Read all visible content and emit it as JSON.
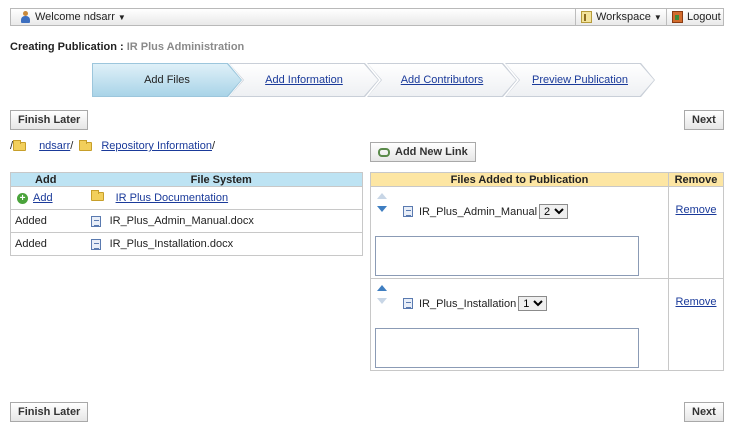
{
  "topbar": {
    "user_label": "Welcome ndsarr",
    "workspace_label": "Workspace",
    "logout_label": "Logout"
  },
  "page": {
    "title_prefix": "Creating Publication : ",
    "title_repo": "IR Plus Administration"
  },
  "steps": [
    {
      "label": "Add Files",
      "active": true
    },
    {
      "label": "Add Information",
      "active": false
    },
    {
      "label": "Add Contributors",
      "active": false
    },
    {
      "label": "Preview Publication",
      "active": false
    }
  ],
  "buttons": {
    "finish_later": "Finish Later",
    "next": "Next",
    "add_new_link": "Add New Link"
  },
  "breadcrumb": {
    "root": "/",
    "user_folder": "ndsarr",
    "sep1": "/",
    "repo_folder": "Repository Information",
    "sep2": "/"
  },
  "left_table": {
    "headers": {
      "add": "Add",
      "file_system": "File System"
    },
    "rows": [
      {
        "add": "Add",
        "name": "IR Plus Documentation",
        "kind": "folder"
      },
      {
        "add": "Added",
        "name": "IR_Plus_Admin_Manual.docx",
        "kind": "file"
      },
      {
        "add": "Added",
        "name": "IR_Plus_Installation.docx",
        "kind": "file"
      }
    ]
  },
  "right_table": {
    "headers": {
      "files": "Files Added to Publication",
      "remove": "Remove"
    },
    "rows": [
      {
        "name": "IR_Plus_Admin_Manual",
        "order": "2",
        "description": "",
        "remove": "Remove"
      },
      {
        "name": "IR_Plus_Installation",
        "order": "1",
        "description": "",
        "remove": "Remove"
      }
    ]
  },
  "colors": {
    "left_header": "#bde3f3",
    "right_header": "#fde6a3",
    "active_step": "#a9d4e8",
    "link": "#1a3a9a"
  }
}
